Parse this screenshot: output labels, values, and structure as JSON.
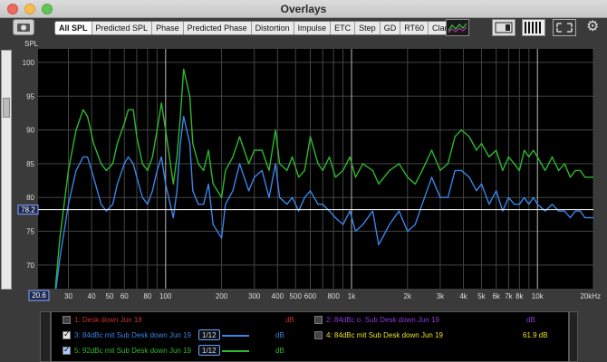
{
  "window": {
    "title": "Overlays"
  },
  "tabs": [
    {
      "label": "All SPL",
      "active": true
    },
    {
      "label": "Predicted SPL"
    },
    {
      "label": "Phase"
    },
    {
      "label": "Predicted Phase"
    },
    {
      "label": "Distortion"
    },
    {
      "label": "Impulse"
    },
    {
      "label": "ETC"
    },
    {
      "label": "Step"
    },
    {
      "label": "GD"
    },
    {
      "label": "RT60"
    },
    {
      "label": "Clarity"
    }
  ],
  "icons": [
    "camera-icon",
    "spectrum-icon",
    "window-icon",
    "bars-icon",
    "expand-icon",
    "gear-icon"
  ],
  "plot": {
    "y_axis_label": "SPL",
    "y_ticks": [
      "100",
      "95",
      "90",
      "85",
      "80",
      "75",
      "70"
    ],
    "x_ticks": [
      "30",
      "40",
      "50",
      "60",
      "80",
      "100",
      "200",
      "300",
      "400",
      "500",
      "600",
      "800",
      "1k",
      "2k",
      "3k",
      "4k",
      "5k",
      "6k",
      "7k",
      "8k",
      "10k",
      "20kHz"
    ],
    "cursor_y_readout": "78.2",
    "cursor_x_readout": "20.6"
  },
  "legend": [
    {
      "id": "1",
      "label": "1: Desk down Jun 18",
      "unit": "dB",
      "checked": false,
      "color": "#c0302a"
    },
    {
      "id": "3",
      "label": "3: 84dBc mit Sub Desk down Jun 19",
      "unit": "dB",
      "checked": true,
      "color": "#3b84e6",
      "smoothing": "1/12"
    },
    {
      "id": "5",
      "label": "5: 92dBc mit Sub Desk down Jun 19",
      "unit": "dB",
      "checked": true,
      "color": "#2eb82e",
      "smoothing": "1/12"
    },
    {
      "id": "2",
      "label": "2: 84dBc o. Sub Desk down Jun 19",
      "unit": "dB",
      "checked": false,
      "color": "#8a3ad6"
    },
    {
      "id": "4",
      "label": "4: 84dBc mit Sub Desk down Jun 19",
      "unit": "dB",
      "checked": false,
      "color": "#e8e02a",
      "value": "61.9 dB"
    }
  ],
  "chart_data": {
    "type": "line",
    "title": "",
    "xlabel": "",
    "ylabel": "SPL",
    "xlim": [
      20.6,
      20000
    ],
    "ylim": [
      66.5,
      102
    ],
    "x_scale": "log",
    "grid": true,
    "series": [
      {
        "name": "5: 92dBc mit Sub Desk down Jun 19",
        "color": "#2eb82e",
        "x": [
          23,
          25,
          27,
          30,
          33,
          36,
          38,
          41,
          45,
          48,
          52,
          55,
          60,
          63,
          67,
          70,
          75,
          80,
          85,
          90,
          95,
          100,
          110,
          115,
          120,
          125,
          135,
          140,
          150,
          160,
          170,
          180,
          200,
          210,
          230,
          250,
          280,
          300,
          330,
          360,
          390,
          410,
          450,
          480,
          520,
          560,
          600,
          660,
          700,
          760,
          820,
          900,
          980,
          1050,
          1150,
          1300,
          1400,
          1600,
          1800,
          2000,
          2200,
          2400,
          2700,
          3000,
          3300,
          3600,
          3900,
          4300,
          4700,
          5000,
          5500,
          6000,
          6500,
          7000,
          7500,
          8000,
          8500,
          9000,
          9500,
          10000,
          11000,
          12000,
          13000,
          14000,
          15000,
          16000,
          17000,
          18000,
          20000
        ],
        "y": [
          45,
          62,
          74,
          84,
          90,
          93,
          92,
          88,
          85,
          84,
          85,
          88,
          91,
          93,
          93,
          89,
          85,
          84,
          86,
          90,
          94,
          90,
          82,
          86,
          92,
          99,
          95,
          88,
          85,
          84,
          87,
          82,
          80,
          84,
          86,
          89,
          85,
          87,
          87,
          84,
          90,
          85,
          84,
          86,
          83,
          84,
          89,
          85,
          84,
          86,
          83,
          84,
          86,
          83,
          85,
          84,
          82,
          84,
          85,
          83,
          82,
          84,
          87,
          84,
          85,
          89,
          90,
          89,
          87,
          88,
          86,
          87,
          84,
          86,
          85,
          84,
          87,
          86,
          87,
          86,
          84,
          86,
          84,
          85,
          83,
          84,
          84,
          83,
          83
        ]
      },
      {
        "name": "3: 84dBc mit Sub Desk down Jun 19",
        "color": "#3b84e6",
        "x": [
          23,
          25,
          27,
          30,
          33,
          36,
          38,
          41,
          45,
          48,
          52,
          55,
          60,
          63,
          67,
          70,
          75,
          80,
          85,
          90,
          95,
          100,
          110,
          115,
          120,
          125,
          135,
          140,
          150,
          160,
          170,
          180,
          200,
          210,
          230,
          250,
          280,
          300,
          330,
          360,
          390,
          410,
          450,
          480,
          520,
          560,
          600,
          660,
          700,
          760,
          820,
          900,
          980,
          1050,
          1150,
          1300,
          1400,
          1600,
          1800,
          2000,
          2200,
          2400,
          2700,
          3000,
          3300,
          3600,
          3900,
          4300,
          4700,
          5000,
          5500,
          6000,
          6500,
          7000,
          7500,
          8000,
          8500,
          9000,
          9500,
          10000,
          11000,
          12000,
          13000,
          14000,
          15000,
          16000,
          17000,
          18000,
          20000
        ],
        "y": [
          42,
          60,
          71,
          79,
          84,
          86,
          86,
          83,
          79,
          78,
          79,
          82,
          85,
          86,
          85,
          83,
          80,
          79,
          81,
          84,
          86,
          82,
          77,
          81,
          88,
          92,
          88,
          81,
          79,
          79,
          82,
          76,
          74,
          79,
          81,
          85,
          81,
          83,
          84,
          80,
          85,
          80,
          79,
          80,
          78,
          80,
          81,
          79,
          79,
          78,
          77,
          76,
          78,
          75,
          76,
          78,
          73,
          76,
          78,
          75,
          76,
          79,
          83,
          80,
          80,
          84,
          84,
          83,
          81,
          82,
          79,
          81,
          78,
          80,
          79,
          79,
          80,
          79,
          80,
          79,
          78,
          79,
          78,
          78,
          77,
          78,
          78,
          77,
          77
        ]
      }
    ],
    "cursor": {
      "y": 78.2,
      "x": 20.6
    }
  }
}
